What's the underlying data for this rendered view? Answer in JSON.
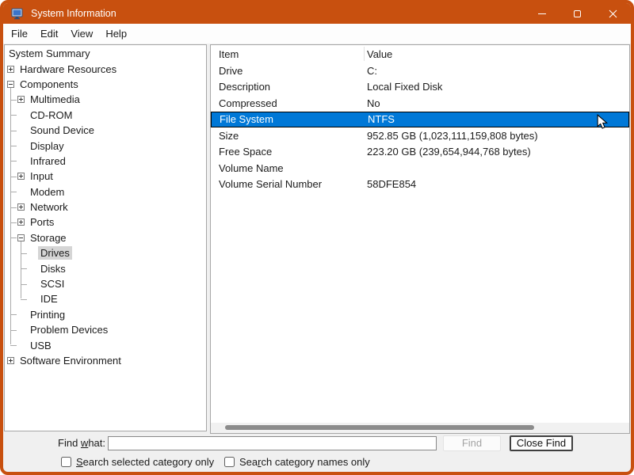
{
  "window": {
    "title": "System Information"
  },
  "titlebar": {
    "app_icon": "computer-monitor-icon",
    "controls": [
      "minimize",
      "maximize",
      "close"
    ]
  },
  "menu": {
    "items": [
      "File",
      "Edit",
      "View",
      "Help"
    ]
  },
  "tree": {
    "items": [
      {
        "label": "System Summary",
        "level": 0,
        "expander": "none"
      },
      {
        "label": "Hardware Resources",
        "level": 0,
        "expander": "plus"
      },
      {
        "label": "Components",
        "level": 0,
        "expander": "minus"
      },
      {
        "label": "Multimedia",
        "level": 1,
        "expander": "plus"
      },
      {
        "label": "CD-ROM",
        "level": 1,
        "expander": "none"
      },
      {
        "label": "Sound Device",
        "level": 1,
        "expander": "none"
      },
      {
        "label": "Display",
        "level": 1,
        "expander": "none"
      },
      {
        "label": "Infrared",
        "level": 1,
        "expander": "none"
      },
      {
        "label": "Input",
        "level": 1,
        "expander": "plus"
      },
      {
        "label": "Modem",
        "level": 1,
        "expander": "none"
      },
      {
        "label": "Network",
        "level": 1,
        "expander": "plus"
      },
      {
        "label": "Ports",
        "level": 1,
        "expander": "plus"
      },
      {
        "label": "Storage",
        "level": 1,
        "expander": "minus"
      },
      {
        "label": "Drives",
        "level": 2,
        "expander": "none",
        "selected": true
      },
      {
        "label": "Disks",
        "level": 2,
        "expander": "none"
      },
      {
        "label": "SCSI",
        "level": 2,
        "expander": "none"
      },
      {
        "label": "IDE",
        "level": 2,
        "expander": "none"
      },
      {
        "label": "Printing",
        "level": 1,
        "expander": "none"
      },
      {
        "label": "Problem Devices",
        "level": 1,
        "expander": "none"
      },
      {
        "label": "USB",
        "level": 1,
        "expander": "none"
      },
      {
        "label": "Software Environment",
        "level": 0,
        "expander": "plus"
      }
    ]
  },
  "list": {
    "columns": [
      "Item",
      "Value"
    ],
    "rows": [
      {
        "item": "Drive",
        "value": "C:"
      },
      {
        "item": "Description",
        "value": "Local Fixed Disk"
      },
      {
        "item": "Compressed",
        "value": "No"
      },
      {
        "item": "File System",
        "value": "NTFS",
        "selected": true
      },
      {
        "item": "Size",
        "value": "952.85 GB (1,023,111,159,808 bytes)"
      },
      {
        "item": "Free Space",
        "value": "223.20 GB (239,654,944,768 bytes)"
      },
      {
        "item": "Volume Name",
        "value": ""
      },
      {
        "item": "Volume Serial Number",
        "value": "58DFE854"
      }
    ]
  },
  "find": {
    "label_pre": "Find ",
    "label_mn": "w",
    "label_post": "hat:",
    "input_value": "",
    "find_button": "Find",
    "close_button": "Close Find"
  },
  "checkboxes": {
    "cb1": {
      "pre": "",
      "mn": "S",
      "post": "earch selected category only",
      "checked": false
    },
    "cb2": {
      "pre": "Sea",
      "mn": "r",
      "post": "ch category names only",
      "checked": false
    }
  },
  "colors": {
    "titlebar": "#C8500F",
    "selection_blue": "#0078D7",
    "tree_selection_gray": "#D5D5D5",
    "background": "#F0F0F0"
  }
}
